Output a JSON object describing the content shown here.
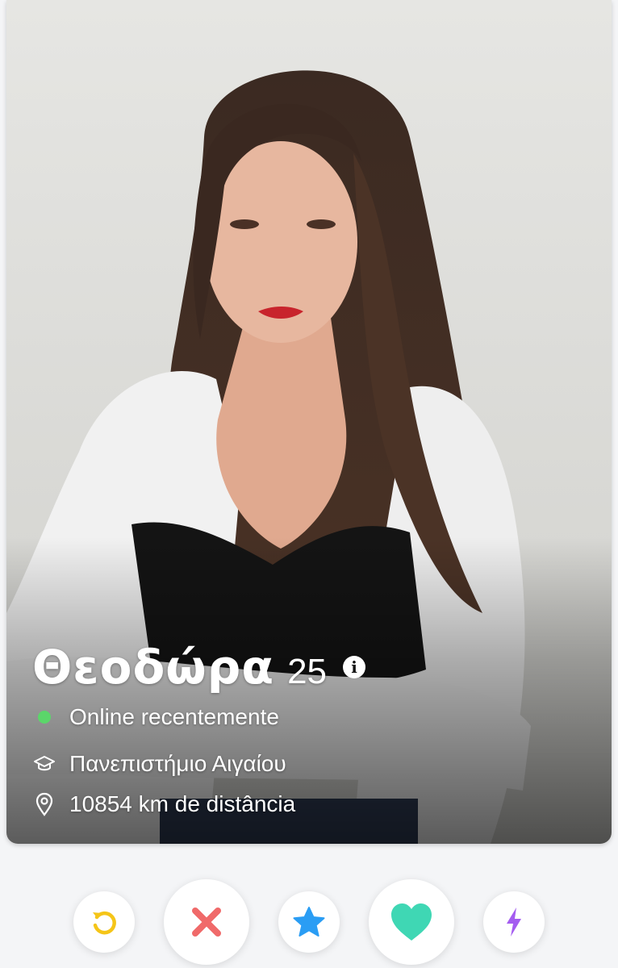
{
  "profile": {
    "name": "Θεοδώρα",
    "age": "25",
    "info_icon": "i",
    "status": "Online recentemente",
    "school": "Πανεπιστήμιο Αιγαίου",
    "distance": "10854 km de distância"
  },
  "icons": {
    "info": "info-icon",
    "online": "online-dot-icon",
    "school": "graduation-cap-icon",
    "location": "location-pin-icon",
    "rewind": "rewind-icon",
    "nope": "x-icon",
    "super_like": "star-icon",
    "like": "heart-icon",
    "boost": "lightning-icon"
  },
  "colors": {
    "online": "#5bd66a",
    "rewind": "#f5c518",
    "nope": "#f06a6a",
    "super_like": "#2a9df4",
    "like": "#3fd7b4",
    "boost": "#a45cf0"
  }
}
